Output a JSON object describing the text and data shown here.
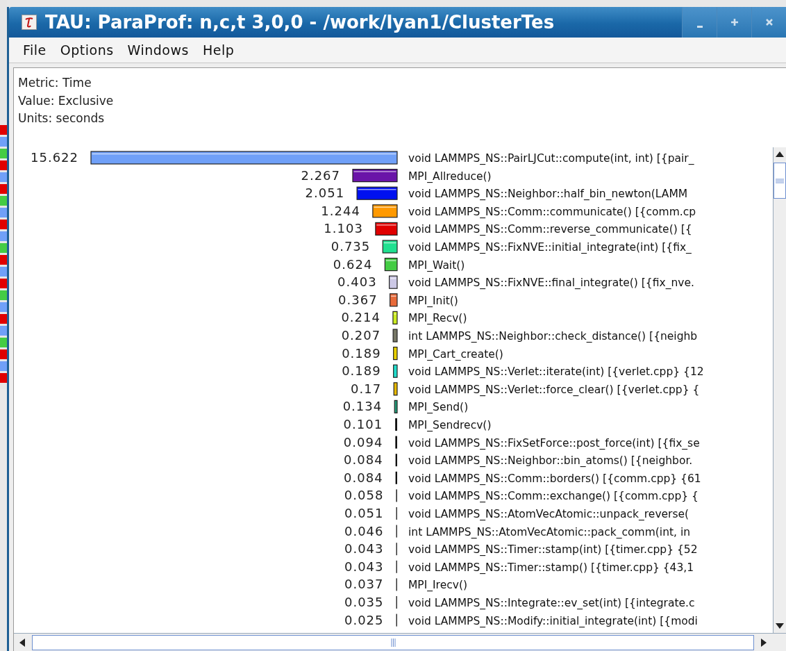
{
  "window": {
    "title": "TAU: ParaProf: n,c,t 3,0,0 - /work/lyan1/ClusterTes"
  },
  "menu": [
    "File",
    "Options",
    "Windows",
    "Help"
  ],
  "header_lines": [
    "Metric: Time",
    "Value: Exclusive",
    "Units: seconds"
  ],
  "chart_data": {
    "type": "bar",
    "orientation": "horizontal",
    "data_labels": true,
    "categories": [
      "void LAMMPS_NS::PairLJCut::compute(int, int) [{pair_",
      "MPI_Allreduce()",
      "void LAMMPS_NS::Neighbor::half_bin_newton(LAMM",
      "void LAMMPS_NS::Comm::communicate() [{comm.cp",
      "void LAMMPS_NS::Comm::reverse_communicate() [{",
      "void LAMMPS_NS::FixNVE::initial_integrate(int) [{fix_",
      "MPI_Wait()",
      "void LAMMPS_NS::FixNVE::final_integrate() [{fix_nve.",
      "MPI_Init()",
      "MPI_Recv()",
      "int LAMMPS_NS::Neighbor::check_distance() [{neighb",
      "MPI_Cart_create()",
      "void LAMMPS_NS::Verlet::iterate(int) [{verlet.cpp} {12",
      "void LAMMPS_NS::Verlet::force_clear() [{verlet.cpp} {",
      "MPI_Send()",
      "MPI_Sendrecv()",
      "void LAMMPS_NS::FixSetForce::post_force(int) [{fix_se",
      "void LAMMPS_NS::Neighbor::bin_atoms() [{neighbor.",
      "void LAMMPS_NS::Comm::borders() [{comm.cpp} {61",
      "void LAMMPS_NS::Comm::exchange() [{comm.cpp} {",
      "void LAMMPS_NS::AtomVecAtomic::unpack_reverse(",
      "int LAMMPS_NS::AtomVecAtomic::pack_comm(int, in",
      "void LAMMPS_NS::Timer::stamp(int) [{timer.cpp} {52",
      "void LAMMPS_NS::Timer::stamp() [{timer.cpp} {43,1",
      "MPI_Irecv()",
      "void LAMMPS_NS::Integrate::ev_set(int) [{integrate.c",
      "void LAMMPS_NS::Modify::initial_integrate(int) [{modi"
    ],
    "values": [
      15.622,
      2.267,
      2.051,
      1.244,
      1.103,
      0.735,
      0.624,
      0.403,
      0.367,
      0.214,
      0.207,
      0.189,
      0.189,
      0.17,
      0.134,
      0.101,
      0.094,
      0.084,
      0.084,
      0.058,
      0.051,
      0.046,
      0.043,
      0.043,
      0.037,
      0.035,
      0.025
    ],
    "value_labels": [
      "15.622",
      "2.267",
      "2.051",
      "1.244",
      "1.103",
      "0.735",
      "0.624",
      "0.403",
      "0.367",
      "0.214",
      "0.207",
      "0.189",
      "0.189",
      "0.17",
      "0.134",
      "0.101",
      "0.094",
      "0.084",
      "0.084",
      "0.058",
      "0.051",
      "0.046",
      "0.043",
      "0.043",
      "0.037",
      "0.035",
      "0.025"
    ],
    "colors": [
      "#70a0f8",
      "#6a14a8",
      "#0010f0",
      "#ff9900",
      "#e00000",
      "#20e090",
      "#44cc44",
      "#ccc8e6",
      "#e86a3a",
      "#ccee22",
      "#777766",
      "#e8d000",
      "#22ddcc",
      "#e8b800",
      "#229977",
      "#111111",
      "#111111",
      "#111111",
      "#111111",
      "#333333",
      "#333333",
      "#333333",
      "#333333",
      "#333333",
      "#333333",
      "#333333",
      "#333333"
    ]
  }
}
